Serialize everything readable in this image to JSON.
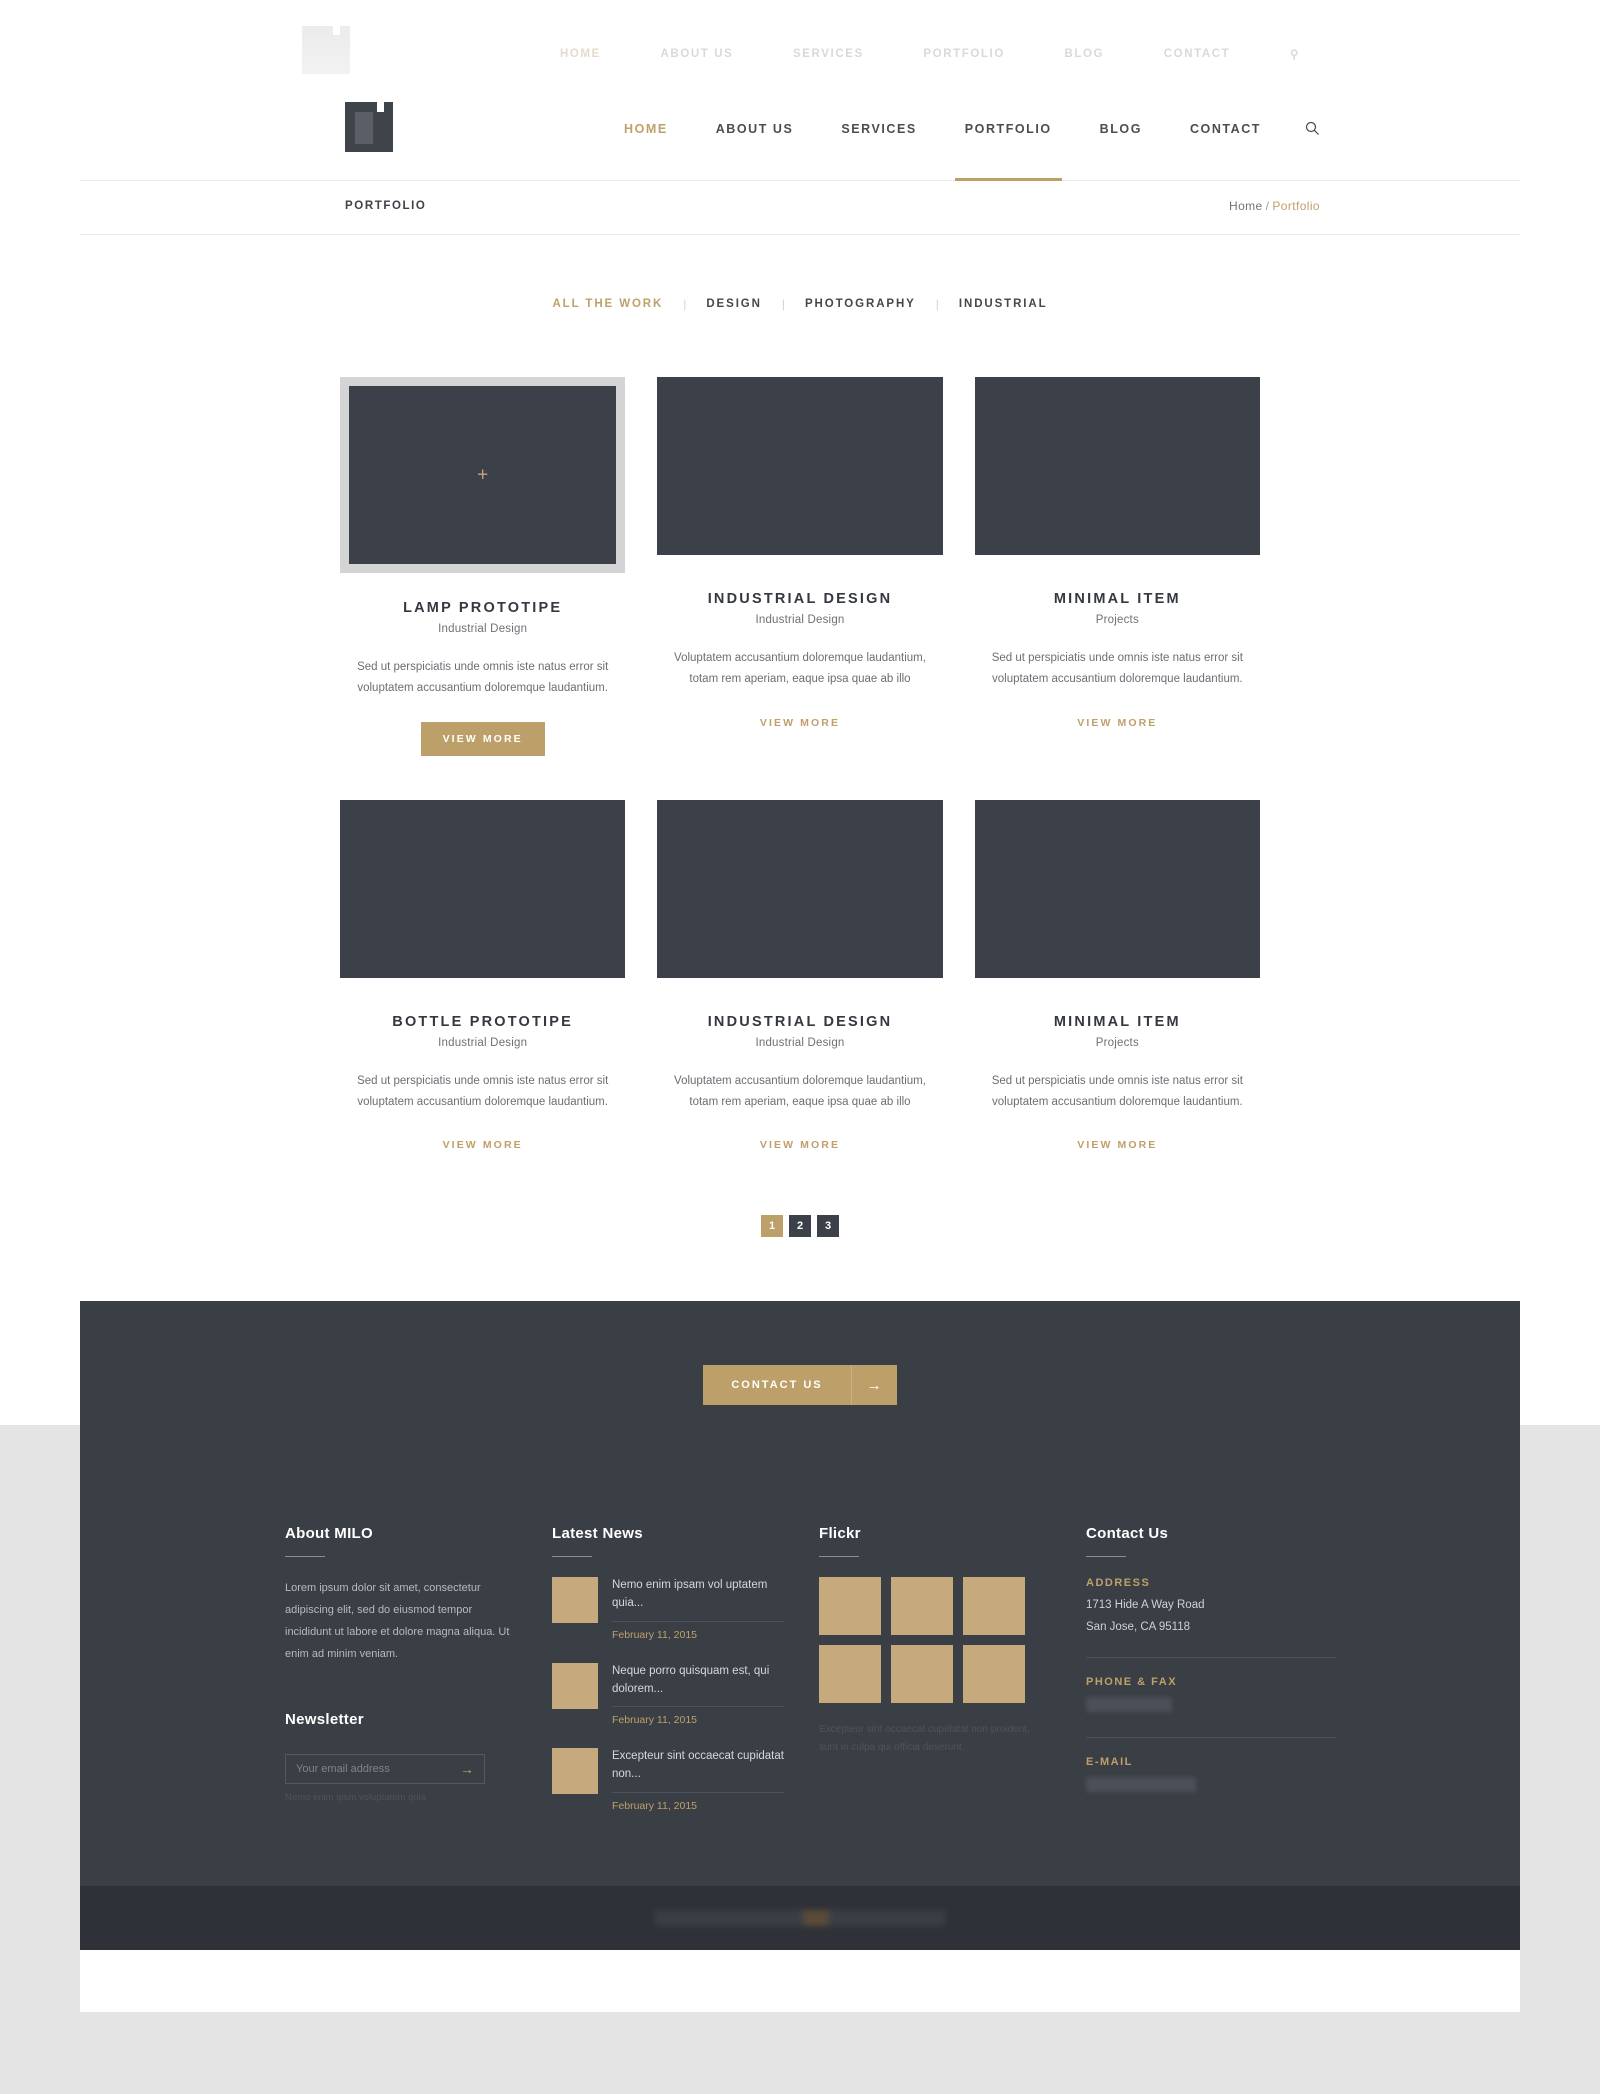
{
  "site": {
    "brand": "MILO"
  },
  "ghost_nav": {
    "items": [
      "HOME",
      "ABOUT US",
      "SERVICES",
      "PORTFOLIO",
      "BLOG",
      "CONTACT"
    ],
    "search_icon": "search-icon"
  },
  "header": {
    "logo_name": "milo-logo",
    "nav": [
      {
        "label": "HOME",
        "state": "active"
      },
      {
        "label": "ABOUT US",
        "state": ""
      },
      {
        "label": "SERVICES",
        "state": ""
      },
      {
        "label": "PORTFOLIO",
        "state": "current"
      },
      {
        "label": "BLOG",
        "state": ""
      },
      {
        "label": "CONTACT",
        "state": ""
      }
    ],
    "search_icon": "search-icon"
  },
  "subheader": {
    "page_title": "PORTFOLIO",
    "breadcrumb_home": "Home",
    "breadcrumb_sep": "/",
    "breadcrumb_current": "Portfolio"
  },
  "filters": [
    {
      "label": "ALL THE WORK",
      "active": true
    },
    {
      "label": "DESIGN",
      "active": false
    },
    {
      "label": "PHOTOGRAPHY",
      "active": false
    },
    {
      "label": "INDUSTRIAL",
      "active": false
    }
  ],
  "filter_separator": "|",
  "portfolio": {
    "row1": [
      {
        "title": "LAMP PROTOTIPE",
        "subtitle": "Industrial Design",
        "description": "Sed ut perspiciatis unde omnis iste natus error sit voluptatem accusantium doloremque laudantium.",
        "cta": "VIEW MORE",
        "cta_style": "button",
        "hovered": true,
        "overlay_icon": "plus-icon"
      },
      {
        "title": "INDUSTRIAL DESIGN",
        "subtitle": "Industrial Design",
        "description": "Voluptatem accusantium doloremque laudantium, totam rem aperiam, eaque ipsa quae ab illo",
        "cta": "VIEW MORE",
        "cta_style": "link",
        "hovered": false
      },
      {
        "title": "MINIMAL ITEM",
        "subtitle": "Projects",
        "description": "Sed ut perspiciatis unde omnis iste natus error sit voluptatem accusantium doloremque laudantium.",
        "cta": "VIEW MORE",
        "cta_style": "link",
        "hovered": false
      }
    ],
    "row2": [
      {
        "title": "BOTTLE PROTOTIPE",
        "subtitle": "Industrial Design",
        "description": "Sed ut perspiciatis unde omnis iste natus error sit voluptatem accusantium doloremque laudantium.",
        "cta": "VIEW MORE",
        "cta_style": "link",
        "hovered": false
      },
      {
        "title": "INDUSTRIAL DESIGN",
        "subtitle": "Industrial Design",
        "description": "Voluptatem accusantium doloremque laudantium, totam rem aperiam, eaque ipsa quae ab illo",
        "cta": "VIEW MORE",
        "cta_style": "link",
        "hovered": false
      },
      {
        "title": "MINIMAL ITEM",
        "subtitle": "Projects",
        "description": "Sed ut perspiciatis unde omnis iste natus error sit voluptatem accusantium doloremque laudantium.",
        "cta": "VIEW MORE",
        "cta_style": "link",
        "hovered": false
      }
    ]
  },
  "pagination": {
    "pages": [
      {
        "label": "1",
        "active": true
      },
      {
        "label": "2",
        "active": false
      },
      {
        "label": "3",
        "active": false
      }
    ]
  },
  "cta": {
    "label": "CONTACT US",
    "arrow_icon": "arrow-right-icon"
  },
  "footer": {
    "about": {
      "heading": "About MILO",
      "body": "Lorem ipsum dolor sit amet, consectetur adipiscing elit, sed do eiusmod tempor incididunt ut labore et dolore magna aliqua. Ut enim ad minim veniam."
    },
    "newsletter": {
      "heading": "Newsletter",
      "placeholder": "Your email address",
      "value": "",
      "submit_icon": "arrow-right-icon",
      "note": "Nemo enim ipsm voluptatem quia"
    },
    "news": {
      "heading": "Latest News",
      "items": [
        {
          "title": "Nemo enim ipsam vol uptatem quia...",
          "date": "February 11, 2015"
        },
        {
          "title": "Neque porro quisquam est, qui dolorem...",
          "date": "February 11, 2015"
        },
        {
          "title": "Excepteur sint occaecat cupidatat non...",
          "date": "February 11, 2015"
        }
      ]
    },
    "flickr": {
      "heading": "Flickr",
      "cells": 6,
      "note": "Excepteur sint occaecat cupidatat non proident, sunt in culpa qui officia deserunt."
    },
    "contact": {
      "heading": "Contact Us",
      "address_label": "ADDRESS",
      "address_line1": "1713 Hide A Way Road",
      "address_line2": "San Jose, CA 95118",
      "phone_label": "PHONE & FAX",
      "phone_value": "",
      "email_label": "E-MAIL",
      "email_value": ""
    },
    "bottom_copy": ""
  },
  "colors": {
    "accent": "#bda069",
    "dark": "#3a3e45",
    "thumb": "#3c4049",
    "bottom_bar": "#2e3238"
  }
}
